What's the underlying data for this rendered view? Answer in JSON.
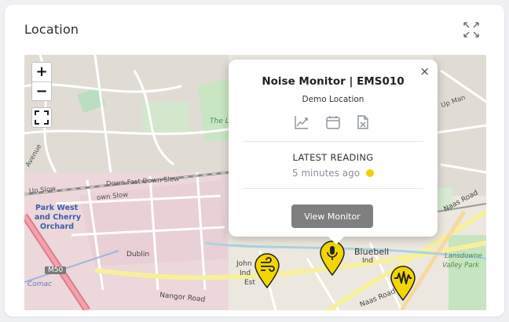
{
  "card": {
    "title": "Location",
    "expand_icon": "expand-arrows-icon"
  },
  "map": {
    "controls": {
      "zoom_in": "+",
      "zoom_out": "−",
      "fullscreen_icon": "fullscreen-icon"
    },
    "labels": {
      "the_lo": "The Lo",
      "avenue": "Avenue",
      "up_man": "Up Man",
      "down_fast_down_slow": "Down Fast Down Slow",
      "up_slow": "Up Slow",
      "down_slow": "own Slow",
      "park_west_1": "Park West",
      "park_west_2": "and Cherry",
      "park_west_3": "Orchard",
      "dublin": "Dublin",
      "john_1": "John",
      "john_2": "Ind",
      "john_3": "Est",
      "m50": "M50",
      "comac": "Comac",
      "nangor_road": "Nangor Road",
      "naas_road_1": "Naas Road",
      "naas_road_2": "Naas Road",
      "bluebell": "Bluebell",
      "ind": "Ind",
      "lansdowne_1": "Lansdowne",
      "lansdowne_2": "Valley Park"
    },
    "markers": [
      {
        "icon": "wind-icon",
        "color": "#f2d600"
      },
      {
        "icon": "microphone-icon",
        "color": "#f2d600"
      },
      {
        "icon": "waveform-icon",
        "color": "#f2d600"
      }
    ]
  },
  "popup": {
    "title": "Noise Monitor | EMS010",
    "subtitle": "Demo Location",
    "icons": [
      "line-chart-icon",
      "calendar-icon",
      "excel-file-icon"
    ],
    "latest_label": "LATEST READING",
    "latest_time": "5 minutes ago",
    "status_color": "#f2d000",
    "button_label": "View Monitor",
    "close_label": "×"
  }
}
